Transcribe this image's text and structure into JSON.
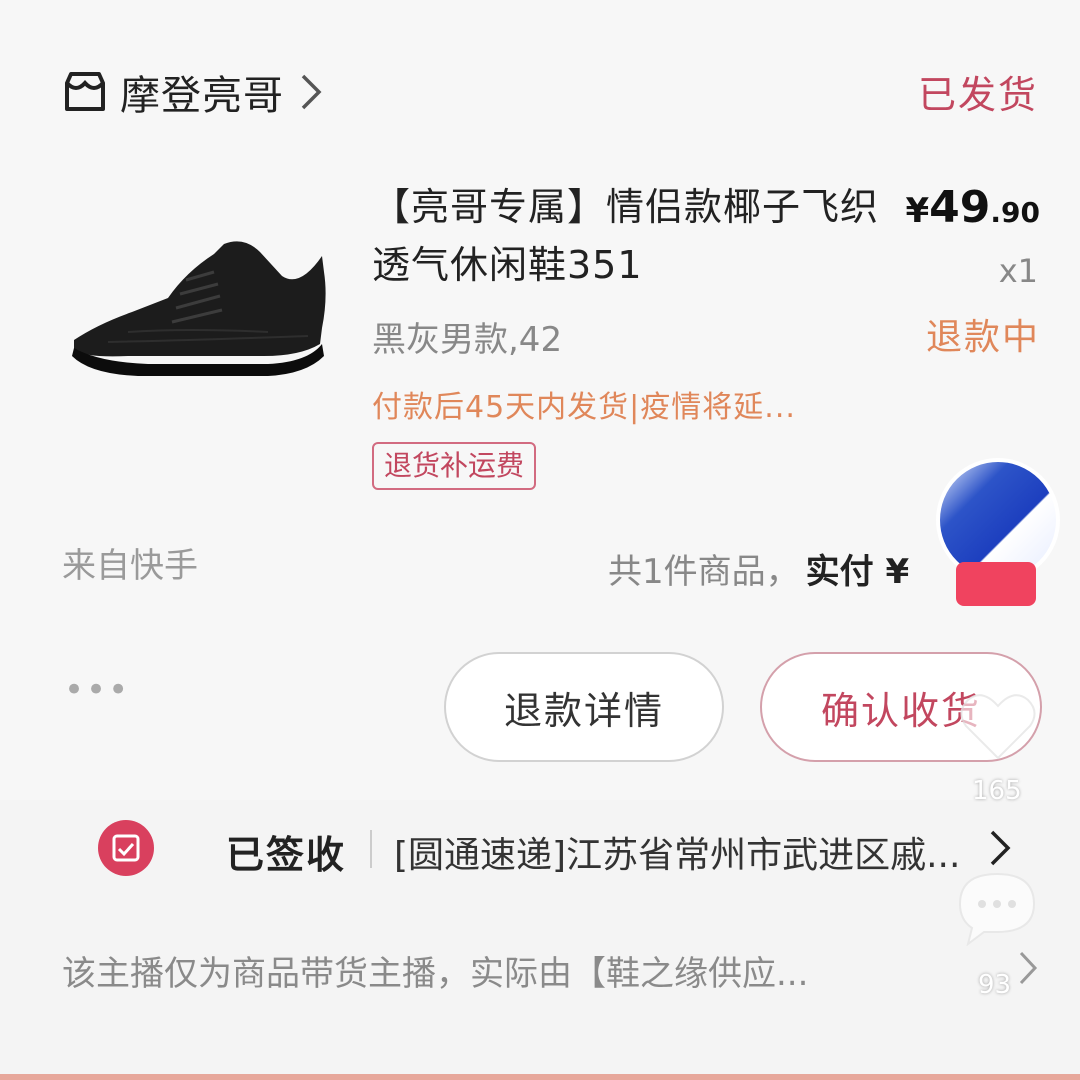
{
  "shop": {
    "name": "摩登亮哥",
    "order_status": "已发货"
  },
  "product": {
    "title": "【亮哥专属】情侣款椰子飞织透气休闲鞋351",
    "price": {
      "currency": "¥",
      "integer": "49",
      "decimal": ".90"
    },
    "quantity": "x1",
    "spec": "黑灰男款,42",
    "refund_status": "退款中",
    "shipping_note": "付款后45天内发货|疫情将延...",
    "tag": "退货补运费"
  },
  "summary": {
    "source": "来自快手",
    "count_text": "共1件商品，",
    "paid_label": "实付 ¥"
  },
  "actions": {
    "more": "•••",
    "refund_detail": "退款详情",
    "confirm_receipt": "确认收货"
  },
  "logistics": {
    "state": "已签收",
    "detail": "[圆通速递]江苏省常州市武进区戚..."
  },
  "disclaimer": "该主播仅为商品带货主播，实际由【鞋之缘供应...",
  "overlay": {
    "like_count": "165",
    "comment_count": "93"
  },
  "colors": {
    "accent": "#c2475f",
    "warning": "#e0875a",
    "follow": "#f0435f"
  }
}
